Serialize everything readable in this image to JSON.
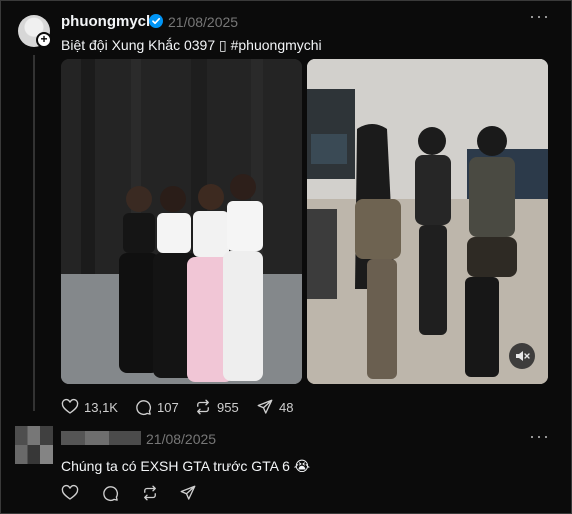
{
  "post": {
    "username": "phuongmychi",
    "date": "21/08/2025",
    "more_label": "···",
    "caption": "Biệt đội Xung Khắc 0397 ▯ #phuongmychi",
    "media": [
      {
        "kind": "photo"
      },
      {
        "kind": "video",
        "muted": true
      }
    ],
    "stats": {
      "likes": "13,1K",
      "comments": "107",
      "reposts": "955",
      "shares": "48"
    }
  },
  "reply": {
    "date": "21/08/2025",
    "more_label": "···",
    "text": "Chúng ta có EXSH GTA trước GTA 6 😭"
  },
  "colors": {
    "background": "#0b0b0b",
    "text": "#f3f5f7",
    "muted": "#777777",
    "verified": "#0095f6"
  }
}
